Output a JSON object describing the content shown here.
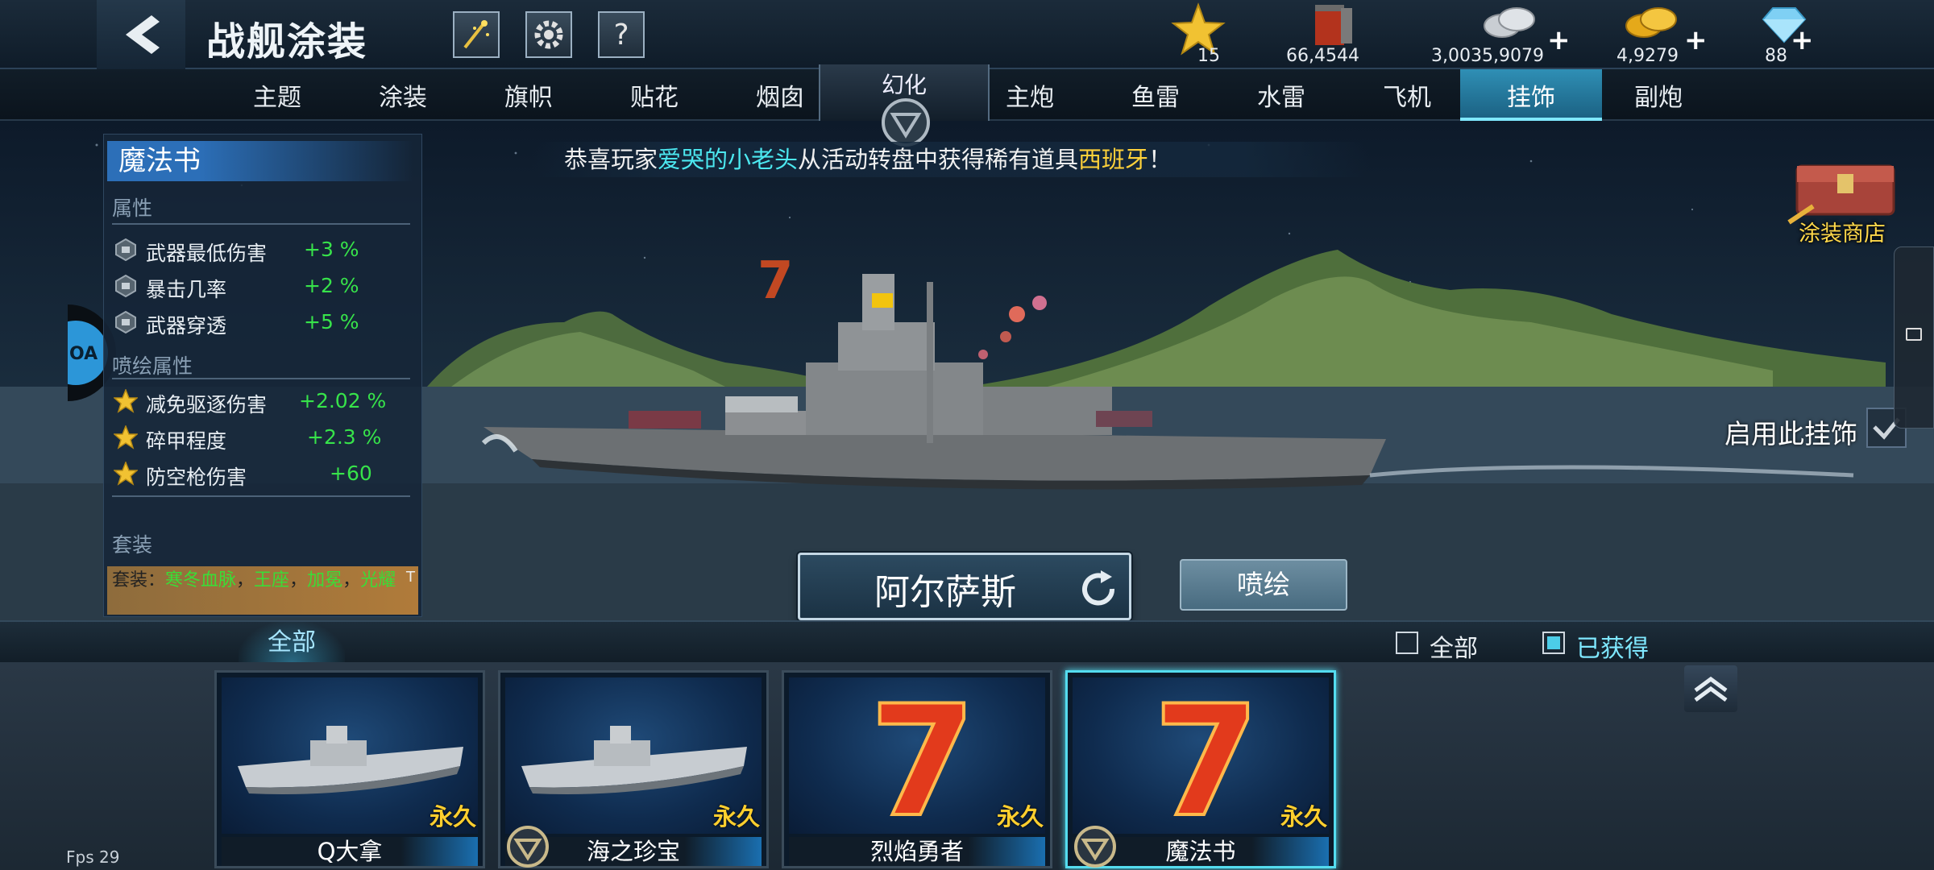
{
  "header": {
    "title": "战舰涂装",
    "resources": [
      {
        "icon": "star-icon",
        "value": "15"
      },
      {
        "icon": "oil-barrel-icon",
        "value": "66,4544"
      },
      {
        "icon": "silver-coins-icon",
        "value": "3,0035,9079",
        "plus": "+"
      },
      {
        "icon": "gold-coins-icon",
        "value": "4,9279",
        "plus": "+"
      },
      {
        "icon": "diamond-icon",
        "value": "88",
        "plus": "+"
      }
    ]
  },
  "tabs": {
    "left": [
      "主题",
      "涂装",
      "旗帜",
      "贴花",
      "烟囱"
    ],
    "center": "幻化",
    "right": [
      "主炮",
      "鱼雷",
      "水雷",
      "飞机",
      "挂饰",
      "副炮"
    ],
    "active": "挂饰"
  },
  "info_panel": {
    "title": "魔法书",
    "attr_header": "属性",
    "attributes": [
      {
        "name": "武器最低伤害",
        "value": "+3 %"
      },
      {
        "name": "暴击几率",
        "value": "+2 %"
      },
      {
        "name": "武器穿透",
        "value": "+5 %"
      }
    ],
    "paint_header": "喷绘属性",
    "paint_attributes": [
      {
        "name": "减免驱逐伤害",
        "value": "+2.02 %"
      },
      {
        "name": "碎甲程度",
        "value": "+2.3 %"
      },
      {
        "name": "防空枪伤害",
        "value": "+60"
      }
    ],
    "suit_header": "套装",
    "suit": {
      "prefix": "套装：",
      "items": [
        "寒冬血脉",
        "王座",
        "加冕",
        "光耀"
      ],
      "sep": "，",
      "tag": "T"
    }
  },
  "notice": {
    "part1": "恭喜玩家",
    "player": "爱哭的小老头",
    "part2": "从活动转盘中获得稀有道具",
    "item": "西班牙",
    "part3": "！"
  },
  "shop_label": "涂装商店",
  "enable_label": "启用此挂饰",
  "ship_name": "阿尔萨斯",
  "paint_button": "喷绘",
  "filter": {
    "tab": "全部",
    "options": [
      {
        "label": "全部",
        "checked": false
      },
      {
        "label": "已获得",
        "checked": true
      }
    ]
  },
  "items": [
    {
      "name": "Q大拿",
      "duration": "永久",
      "type": "ship",
      "badge": false,
      "selected": false
    },
    {
      "name": "海之珍宝",
      "duration": "永久",
      "type": "ship",
      "badge": true,
      "selected": false
    },
    {
      "name": "烈焰勇者",
      "duration": "永久",
      "type": "seven",
      "badge": false,
      "selected": false
    },
    {
      "name": "魔法书",
      "duration": "永久",
      "type": "seven",
      "badge": true,
      "selected": true
    }
  ],
  "fps": "Fps 29",
  "colors": {
    "accent": "#2f8fb5",
    "positive": "#37e34a",
    "gold": "#ffcf2e",
    "cyan": "#4ce8f0"
  }
}
